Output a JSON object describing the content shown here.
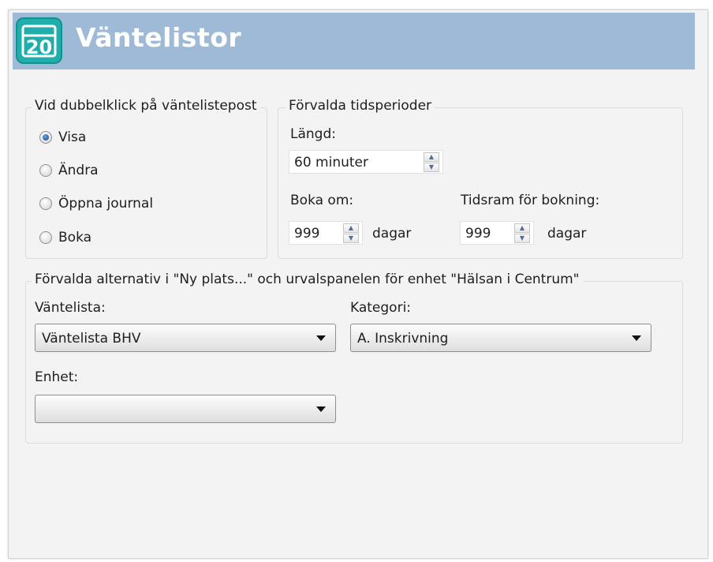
{
  "header": {
    "logo_text": "20",
    "title": "Väntelistor"
  },
  "double_click": {
    "legend": "Vid dubbelklick på väntelistepost",
    "options": [
      "Visa",
      "Ändra",
      "Öppna journal",
      "Boka"
    ],
    "selected": "Visa"
  },
  "periods": {
    "legend": "Förvalda tidsperioder",
    "length_label": "Längd:",
    "length_value": "60 minuter",
    "rebook_label": "Boka om:",
    "rebook_value": "999",
    "rebook_unit": "dagar",
    "timeframe_label": "Tidsram för bokning:",
    "timeframe_value": "999",
    "timeframe_unit": "dagar"
  },
  "defaults": {
    "legend": "Förvalda alternativ i \"Ny plats...\" och urvalspanelen för enhet \"Hälsan i Centrum\"",
    "waitlist_label": "Väntelista:",
    "waitlist_value": "Väntelista BHV",
    "category_label": "Kategori:",
    "category_value": "A. Inskrivning",
    "unit_label": "Enhet:",
    "unit_value": ""
  },
  "colors": {
    "header_bg": "#9fbad7",
    "logo_bg": "#1faeab"
  },
  "icons": {
    "logo": "calendar-20-icon",
    "spin": "spin-arrows-icon",
    "dropdown": "chevron-down-icon"
  }
}
